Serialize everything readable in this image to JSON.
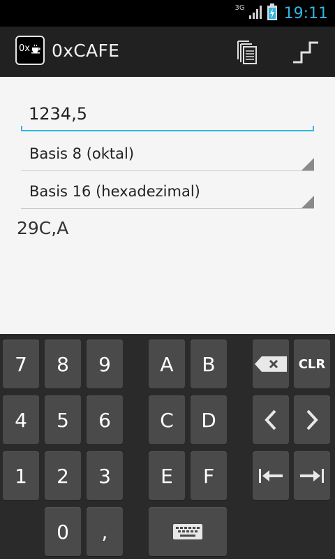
{
  "status_bar": {
    "network_label": "3G",
    "time": "19:11",
    "accent_color": "#33b5e5"
  },
  "action_bar": {
    "app_icon_text": "0x",
    "title": "0xCAFE",
    "icons": [
      "copy-icon",
      "steps-icon"
    ]
  },
  "converter": {
    "input_value": "1234,5",
    "from_base": "Basis 8 (oktal)",
    "to_base": "Basis 16 (hexadezimal)",
    "result": "29C,A"
  },
  "keypad": {
    "keys": {
      "k7": "7",
      "k8": "8",
      "k9": "9",
      "kA": "A",
      "kB": "B",
      "k4": "4",
      "k5": "5",
      "k6": "6",
      "kC": "C",
      "kD": "D",
      "k1": "1",
      "k2": "2",
      "k3": "3",
      "kE": "E",
      "kF": "F",
      "k0": "0",
      "comma": ",",
      "clr": "CLR"
    },
    "icons": [
      "backspace-icon",
      "arrow-left-icon",
      "arrow-right-icon",
      "jump-start-icon",
      "jump-end-icon",
      "keyboard-icon"
    ]
  }
}
